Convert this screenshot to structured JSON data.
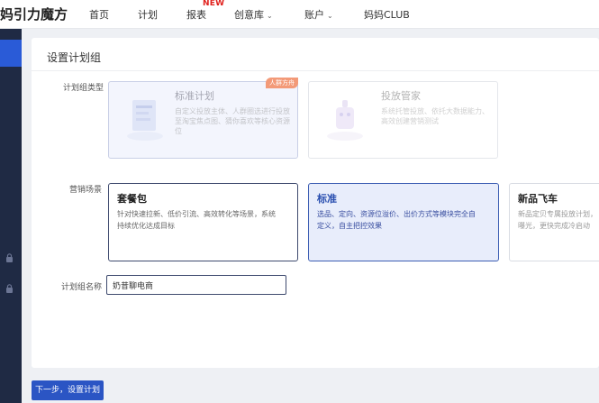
{
  "nav": {
    "logo": "妈引力魔方",
    "items": [
      "首页",
      "计划",
      "报表",
      "创意库",
      "账户",
      "妈妈CLUB"
    ],
    "new_badge": "NEW"
  },
  "panel": {
    "title": "设置计划组",
    "plan_type": {
      "label": "计划组类型",
      "options": [
        {
          "title": "标准计划",
          "desc": "自定义投放主体、人群圈选进行投放至淘宝焦点图、猜你喜欢等核心资源位",
          "badge": "人群方舟"
        },
        {
          "title": "投放管家",
          "desc": "系统托管投放、依托大数据能力、高效创建营销测试"
        }
      ]
    },
    "scene": {
      "label": "营销场景",
      "options": [
        {
          "title": "套餐包",
          "desc": "针对快速拉新、低价引流、高效转化等场景，系统\n持续优化达成目标"
        },
        {
          "title": "标准",
          "desc": "选品、定向、资源位溢价、出价方式等模块完全自\n定义，自主把控效果"
        },
        {
          "title": "新品飞车",
          "desc": "新品定贝专属投放计划，\n曝光，更快完成冷启动"
        }
      ]
    },
    "name": {
      "label": "计划组名称",
      "value": "奶昔聊电商"
    }
  },
  "footer": {
    "next_label": "下一步，设置计划"
  },
  "colors": {
    "primary": "#2b55c4",
    "sidebar": "#1f2a44",
    "selected_bg": "#e8edfb",
    "ribbon": "#f39a78",
    "new_badge": "#e0201c"
  }
}
